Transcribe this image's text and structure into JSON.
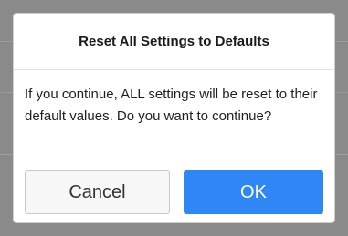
{
  "dialog": {
    "title": "Reset All Settings to Defaults",
    "message": "If you continue, ALL settings will be reset to their default values. Do you want to continue?",
    "cancel_label": "Cancel",
    "ok_label": "OK"
  },
  "colors": {
    "backdrop": "#8a8a8a",
    "dialog_background": "#ffffff",
    "ok_button": "#2f86f5",
    "cancel_button": "#f7f7f7"
  }
}
